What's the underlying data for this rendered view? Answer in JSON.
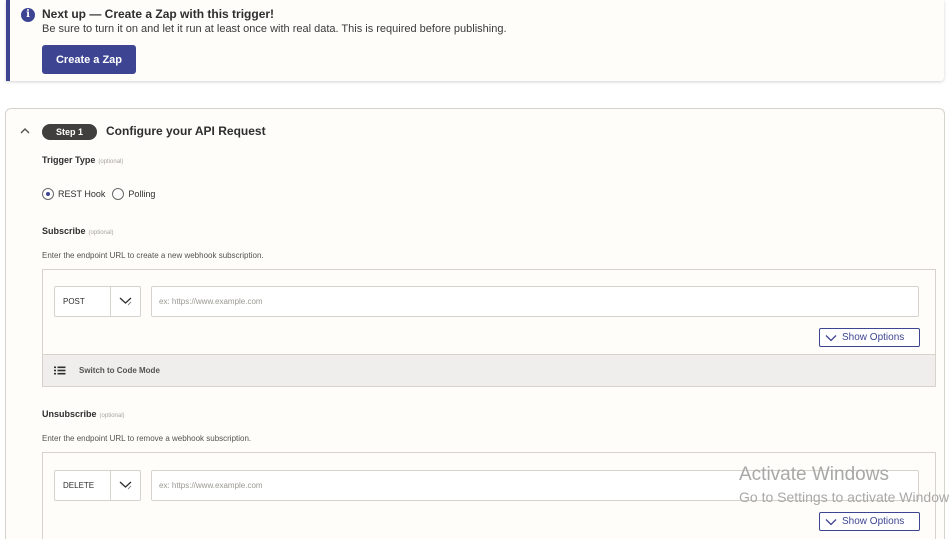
{
  "banner": {
    "icon": "info-icon",
    "title": "Next up — Create a Zap with this trigger!",
    "description": "Be sure to turn it on and let it run at least once with real data. This is required before publishing.",
    "button_label": "Create a Zap",
    "accent_color": "#3d4592"
  },
  "step": {
    "badge": "Step 1",
    "title": "Configure your API Request",
    "collapse_icon": "chevron-up-icon"
  },
  "trigger_type": {
    "label": "Trigger Type",
    "optional": "(optional)",
    "options": [
      "REST Hook",
      "Polling"
    ],
    "selected": "REST Hook"
  },
  "subscribe": {
    "label": "Subscribe",
    "optional": "(optional)",
    "help": "Enter the endpoint URL to create a new webhook subscription.",
    "method": "POST",
    "url_value": "",
    "url_placeholder": "ex: https://www.example.com",
    "show_options": "Show Options",
    "code_mode": "Switch to Code Mode"
  },
  "unsubscribe": {
    "label": "Unsubscribe",
    "optional": "(optional)",
    "help": "Enter the endpoint URL to remove a webhook subscription.",
    "method": "DELETE",
    "url_value": "",
    "url_placeholder": "ex: https://www.example.com",
    "show_options": "Show Options"
  },
  "watermark": {
    "title": "Activate Windows",
    "subtitle": "Go to Settings to activate Windows."
  }
}
